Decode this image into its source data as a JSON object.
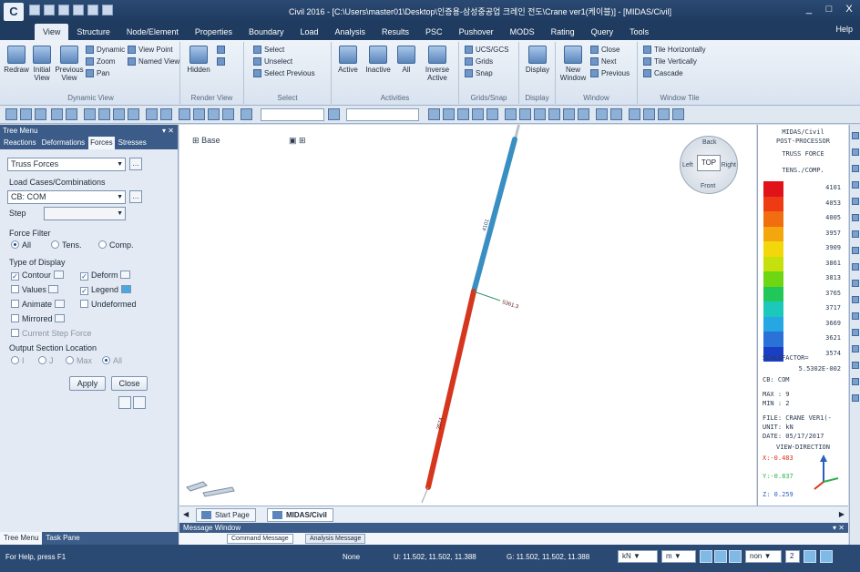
{
  "window": {
    "title": "Civil 2016 - [C:\\Users\\master01\\Desktop\\인증용-삼성중공업 크레인 전도\\Crane ver1(케이블)] - [MIDAS/Civil]",
    "controls": [
      "_",
      "□",
      "X"
    ]
  },
  "menu": {
    "tabs": [
      "View",
      "Structure",
      "Node/Element",
      "Properties",
      "Boundary",
      "Load",
      "Analysis",
      "Results",
      "PSC",
      "Pushover",
      "MODS",
      "Rating",
      "Query",
      "Tools"
    ],
    "active": "View",
    "help": "Help"
  },
  "ribbon": {
    "dynamic_view": {
      "title": "Dynamic View",
      "redraw": "Redraw",
      "initial_view": "Initial View",
      "previous_view": "Previous View",
      "dynamic": "Dynamic",
      "zoom": "Zoom",
      "pan": "Pan",
      "view_point": "View Point",
      "named_view": "Named View"
    },
    "render_view": {
      "title": "Render View",
      "hidden": "Hidden"
    },
    "select": {
      "title": "Select",
      "select": "Select",
      "unselect": "Unselect",
      "select_previous": "Select Previous"
    },
    "activities": {
      "title": "Activities",
      "active": "Active",
      "inactive": "Inactive",
      "all": "All",
      "inverse_active": "Inverse Active"
    },
    "grids_snap": {
      "title": "Grids/Snap",
      "ucs": "UCS/GCS",
      "grids": "Grids",
      "snap": "Snap"
    },
    "display": {
      "title": "Display",
      "display": "Display"
    },
    "window": {
      "title": "Window",
      "new_window": "New Window",
      "close": "Close",
      "next": "Next",
      "previous": "Previous"
    },
    "window_tile": {
      "title": "Window Tile",
      "tile_h": "Tile Horizontally",
      "tile_v": "Tile Vertically",
      "cascade": "Cascade"
    }
  },
  "tree_menu": {
    "title": "Tree Menu",
    "tabs": [
      "Reactions",
      "Deformations",
      "Forces",
      "Stresses"
    ],
    "active_tab": "Forces",
    "result_type": "Truss Forces",
    "load_cases_label": "Load Cases/Combinations",
    "load_case": "CB: COM",
    "step_label": "Step",
    "force_filter_label": "Force Filter",
    "force_filter": [
      {
        "label": "All",
        "on": true
      },
      {
        "label": "Tens.",
        "on": false
      },
      {
        "label": "Comp.",
        "on": false
      }
    ],
    "type_of_display_label": "Type of Display",
    "display_options": [
      {
        "label": "Contour",
        "checked": true
      },
      {
        "label": "Deform",
        "checked": true
      },
      {
        "label": "Values",
        "checked": false
      },
      {
        "label": "Legend",
        "checked": true
      },
      {
        "label": "Animate",
        "checked": false
      },
      {
        "label": "Undeformed",
        "checked": false
      },
      {
        "label": "Mirrored",
        "checked": false
      }
    ],
    "current_step_force": "Current Step Force",
    "output_section_label": "Output Section Location",
    "output_sections": [
      {
        "label": "I",
        "on": false
      },
      {
        "label": "J",
        "on": false
      },
      {
        "label": "Max",
        "on": false
      },
      {
        "label": "All",
        "on": true
      }
    ],
    "apply": "Apply",
    "close": "Close",
    "footer_tabs": [
      "Tree Menu",
      "Task Pane"
    ]
  },
  "viewport": {
    "base_label": "Base",
    "navcube": {
      "back": "Back",
      "front": "Front",
      "left": "Left",
      "right": "Right",
      "top": "TOP"
    },
    "member_labels": [
      "4101",
      "3574"
    ],
    "annotation": "5361.3"
  },
  "legend": {
    "app": "MIDAS/Civil",
    "mode": "POST-PROCESSOR",
    "result": "TRUSS FORCE",
    "component": "TENS./COMP.",
    "values": [
      "4101",
      "4053",
      "4005",
      "3957",
      "3909",
      "3861",
      "3813",
      "3765",
      "3717",
      "3669",
      "3621",
      "3574"
    ],
    "colors": [
      "#e0121a",
      "#ef3b14",
      "#f06e10",
      "#f4a70c",
      "#f2d80a",
      "#c5e00c",
      "#6fd614",
      "#22c75a",
      "#1cc8b9",
      "#24a7e2",
      "#2a71d8",
      "#1b3fc4"
    ],
    "scale_factor_label": "SCALEFACTOR=",
    "scale_factor": "5.5302E-002",
    "case": "CB: COM",
    "max": "MAX : 9",
    "min": "MIN : 2",
    "file": "FILE: CRANE VER1(-",
    "unit": "UNIT: kN",
    "date": "DATE: 05/17/2017",
    "view_direction": "VIEW-DIRECTION",
    "vx": "X:-0.483",
    "vy": "Y:-0.837",
    "vz": "Z: 0.259"
  },
  "doc_tabs": {
    "start_page": "Start Page",
    "midas": "MIDAS/Civil"
  },
  "message_window": {
    "title": "Message Window",
    "tabs": [
      "Command Message",
      "Analysis Message"
    ]
  },
  "status": {
    "hint": "For Help, press F1",
    "node": "None",
    "u": "U: 11.502, 11.502, 11.388",
    "g": "G: 11.502, 11.502, 11.388",
    "force_unit": "kN",
    "length_unit": "m",
    "non": "non",
    "num": "2"
  }
}
